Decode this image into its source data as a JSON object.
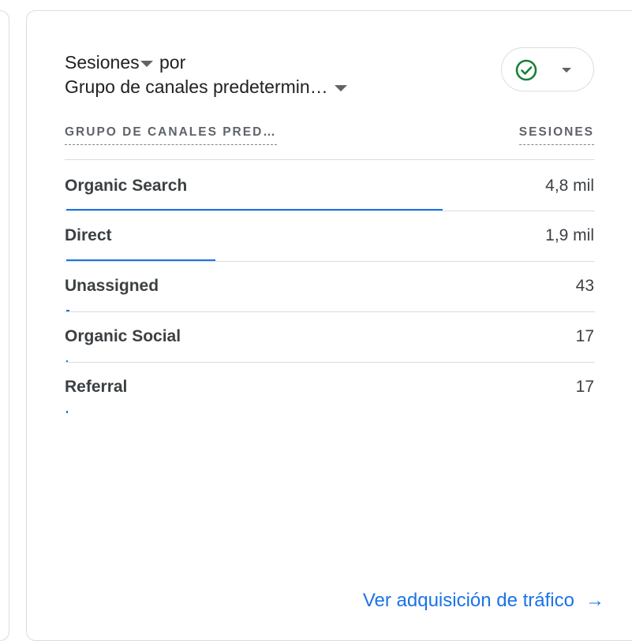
{
  "card": {
    "metric_label": "Sesiones",
    "by_label": "por",
    "dimension_label": "Grupo de canales predetermin…",
    "compare_icon": "check-circle-icon",
    "accent_color": "#1a73e8",
    "check_color": "#188038"
  },
  "table": {
    "headers": {
      "dimension": "GRUPO DE CANALES PRED…",
      "metric": "SESIONES"
    },
    "rows": [
      {
        "label": "Organic Search",
        "value": "4,8 mil",
        "sessions": 4800
      },
      {
        "label": "Direct",
        "value": "1,9 mil",
        "sessions": 1900
      },
      {
        "label": "Unassigned",
        "value": "43",
        "sessions": 43
      },
      {
        "label": "Organic Social",
        "value": "17",
        "sessions": 17
      },
      {
        "label": "Referral",
        "value": "17",
        "sessions": 17
      }
    ]
  },
  "footer": {
    "link_label": "Ver adquisición de tráfico",
    "arrow_icon": "arrow-right-icon"
  }
}
